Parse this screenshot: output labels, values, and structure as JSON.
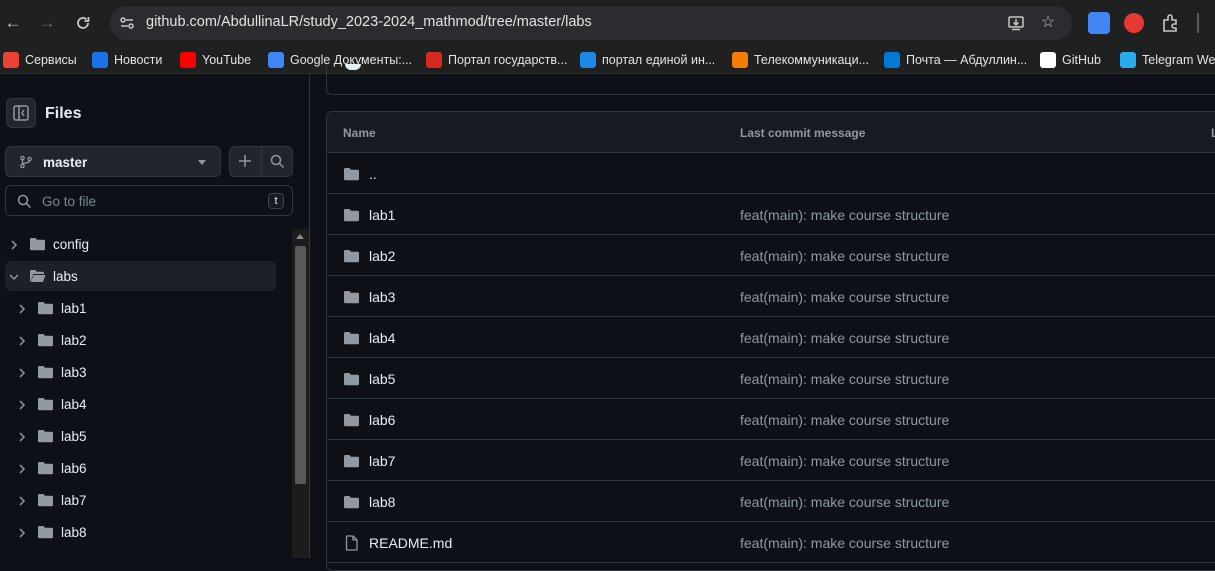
{
  "browser": {
    "url": "github.com/AbdullinaLR/study_2023-2024_mathmod/tree/master/labs",
    "bookmarks": [
      {
        "label": "Сервисы",
        "color": "#ea4335"
      },
      {
        "label": "Новости",
        "color": "#1a73e8"
      },
      {
        "label": "YouTube",
        "color": "#ff0000"
      },
      {
        "label": "Google Документы:...",
        "color": "#4285f4"
      },
      {
        "label": "Портал государств...",
        "color": "#d52b1e"
      },
      {
        "label": "портал единой ин...",
        "color": "#1e88e5"
      },
      {
        "label": "Телекоммуникаци...",
        "color": "#f57c00"
      },
      {
        "label": "Почта — Абдуллин...",
        "color": "#0078d4"
      },
      {
        "label": "GitHub",
        "color": "#ffffff"
      },
      {
        "label": "Telegram Web",
        "color": "#2aabee"
      }
    ]
  },
  "sidebar": {
    "title": "Files",
    "branch": "master",
    "search_placeholder": "Go to file",
    "search_shortcut": "t",
    "tree": [
      {
        "label": "config",
        "expanded": false,
        "depth": 0
      },
      {
        "label": "labs",
        "expanded": true,
        "depth": 0,
        "active": true
      },
      {
        "label": "lab1",
        "expanded": false,
        "depth": 1
      },
      {
        "label": "lab2",
        "expanded": false,
        "depth": 1
      },
      {
        "label": "lab3",
        "expanded": false,
        "depth": 1
      },
      {
        "label": "lab4",
        "expanded": false,
        "depth": 1
      },
      {
        "label": "lab5",
        "expanded": false,
        "depth": 1
      },
      {
        "label": "lab6",
        "expanded": false,
        "depth": 1
      },
      {
        "label": "lab7",
        "expanded": false,
        "depth": 1
      },
      {
        "label": "lab8",
        "expanded": false,
        "depth": 1
      }
    ]
  },
  "table": {
    "headers": {
      "name": "Name",
      "message": "Last commit message",
      "date": "L"
    },
    "rows": [
      {
        "name": "..",
        "type": "folder",
        "message": ""
      },
      {
        "name": "lab1",
        "type": "folder",
        "message": "feat(main): make course structure"
      },
      {
        "name": "lab2",
        "type": "folder",
        "message": "feat(main): make course structure"
      },
      {
        "name": "lab3",
        "type": "folder",
        "message": "feat(main): make course structure"
      },
      {
        "name": "lab4",
        "type": "folder",
        "message": "feat(main): make course structure"
      },
      {
        "name": "lab5",
        "type": "folder",
        "message": "feat(main): make course structure"
      },
      {
        "name": "lab6",
        "type": "folder",
        "message": "feat(main): make course structure"
      },
      {
        "name": "lab7",
        "type": "folder",
        "message": "feat(main): make course structure"
      },
      {
        "name": "lab8",
        "type": "folder",
        "message": "feat(main): make course structure"
      },
      {
        "name": "README.md",
        "type": "file",
        "message": "feat(main): make course structure"
      }
    ]
  },
  "colors": {
    "folder": "#9198a1",
    "background": "#0d1117",
    "border": "#30363d"
  }
}
